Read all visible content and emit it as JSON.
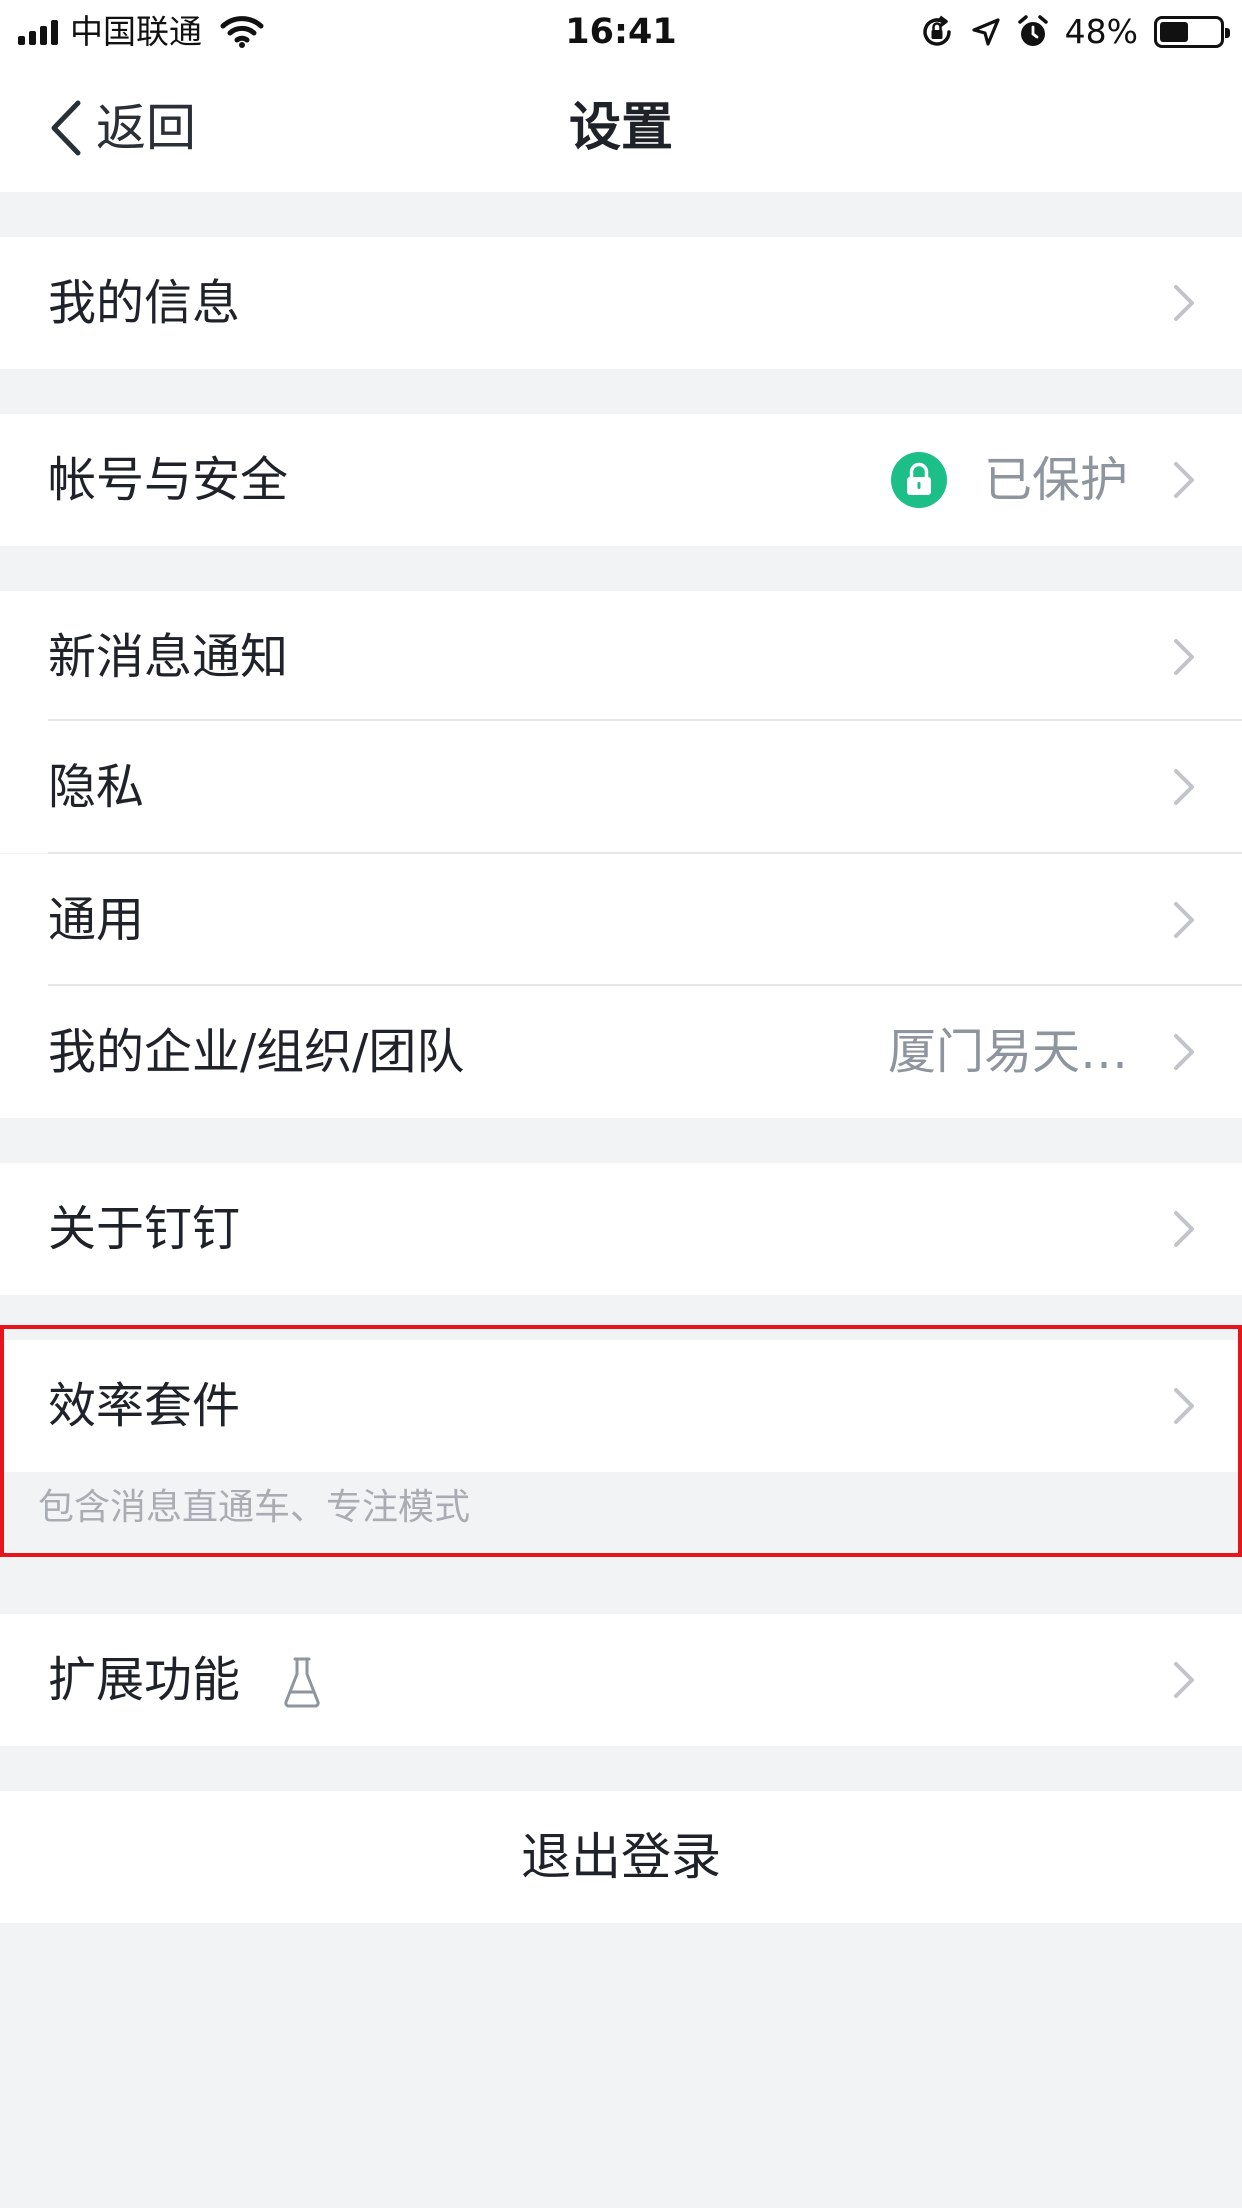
{
  "status_bar": {
    "carrier": "中国联通",
    "time": "16:41",
    "battery_percent": "48%",
    "battery_level": 0.48,
    "icons": [
      "signal-icon",
      "wifi-icon",
      "rotation-lock-icon",
      "location-icon",
      "alarm-icon",
      "battery-icon"
    ]
  },
  "nav": {
    "back_label": "返回",
    "title": "设置"
  },
  "settings": {
    "my_info": "我的信息",
    "account_security": "帐号与安全",
    "account_status": "已保护",
    "notifications": "新消息通知",
    "privacy": "隐私",
    "general": "通用",
    "organization": "我的企业/组织/团队",
    "organization_value": "厦门易天…",
    "about": "关于钉钉",
    "efficiency_suite": "效率套件",
    "efficiency_suite_desc": "包含消息直通车、专注模式",
    "extensions": "扩展功能",
    "logout": "退出登录"
  },
  "colors": {
    "background": "#f2f3f5",
    "lock_badge": "#1bbf87",
    "highlight": "#e8141c",
    "secondary_text": "#8f959e"
  }
}
